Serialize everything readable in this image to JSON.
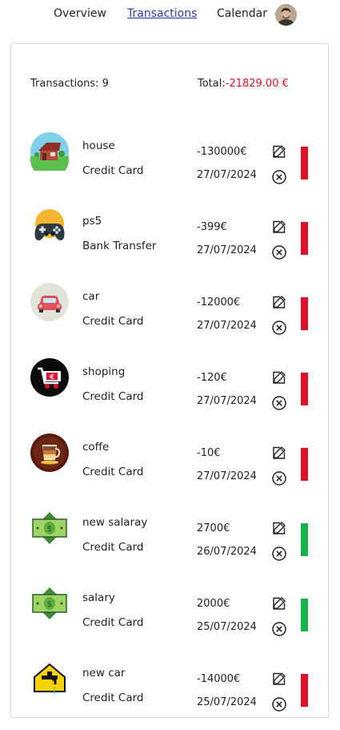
{
  "nav": {
    "overview": "Overview",
    "transactions": "Transactions",
    "calendar": "Calendar"
  },
  "summary": {
    "count_label": "Transactions: 9",
    "total_prefix": "Total:",
    "total_value": "-21829.00 €"
  },
  "colors": {
    "expense": "#e0102a",
    "income": "#17b34a",
    "link_active": "#2b3ea8"
  },
  "transactions": [
    {
      "name": "house",
      "method": "Credit Card",
      "amount": "-130000€",
      "date": "27/07/2024",
      "type": "expense",
      "icon": "house-icon"
    },
    {
      "name": "ps5",
      "method": "Bank Transfer",
      "amount": "-399€",
      "date": "27/07/2024",
      "type": "expense",
      "icon": "gamepad-icon"
    },
    {
      "name": "car",
      "method": "Credit Card",
      "amount": "-12000€",
      "date": "27/07/2024",
      "type": "expense",
      "icon": "car-icon"
    },
    {
      "name": "shoping",
      "method": "Credit Card",
      "amount": "-120€",
      "date": "27/07/2024",
      "type": "expense",
      "icon": "shopping-cart-icon"
    },
    {
      "name": "coffe",
      "method": "Credit Card",
      "amount": "-10€",
      "date": "27/07/2024",
      "type": "expense",
      "icon": "coffee-icon"
    },
    {
      "name": "new salaray",
      "method": "Credit Card",
      "amount": "2700€",
      "date": "26/07/2024",
      "type": "income",
      "icon": "money-icon"
    },
    {
      "name": "salary",
      "method": "Credit Card",
      "amount": "2000€",
      "date": "25/07/2024",
      "type": "income",
      "icon": "money-icon"
    },
    {
      "name": "new car",
      "method": "Credit Card",
      "amount": "-14000€",
      "date": "25/07/2024",
      "type": "expense",
      "icon": "house-tap-icon"
    }
  ]
}
